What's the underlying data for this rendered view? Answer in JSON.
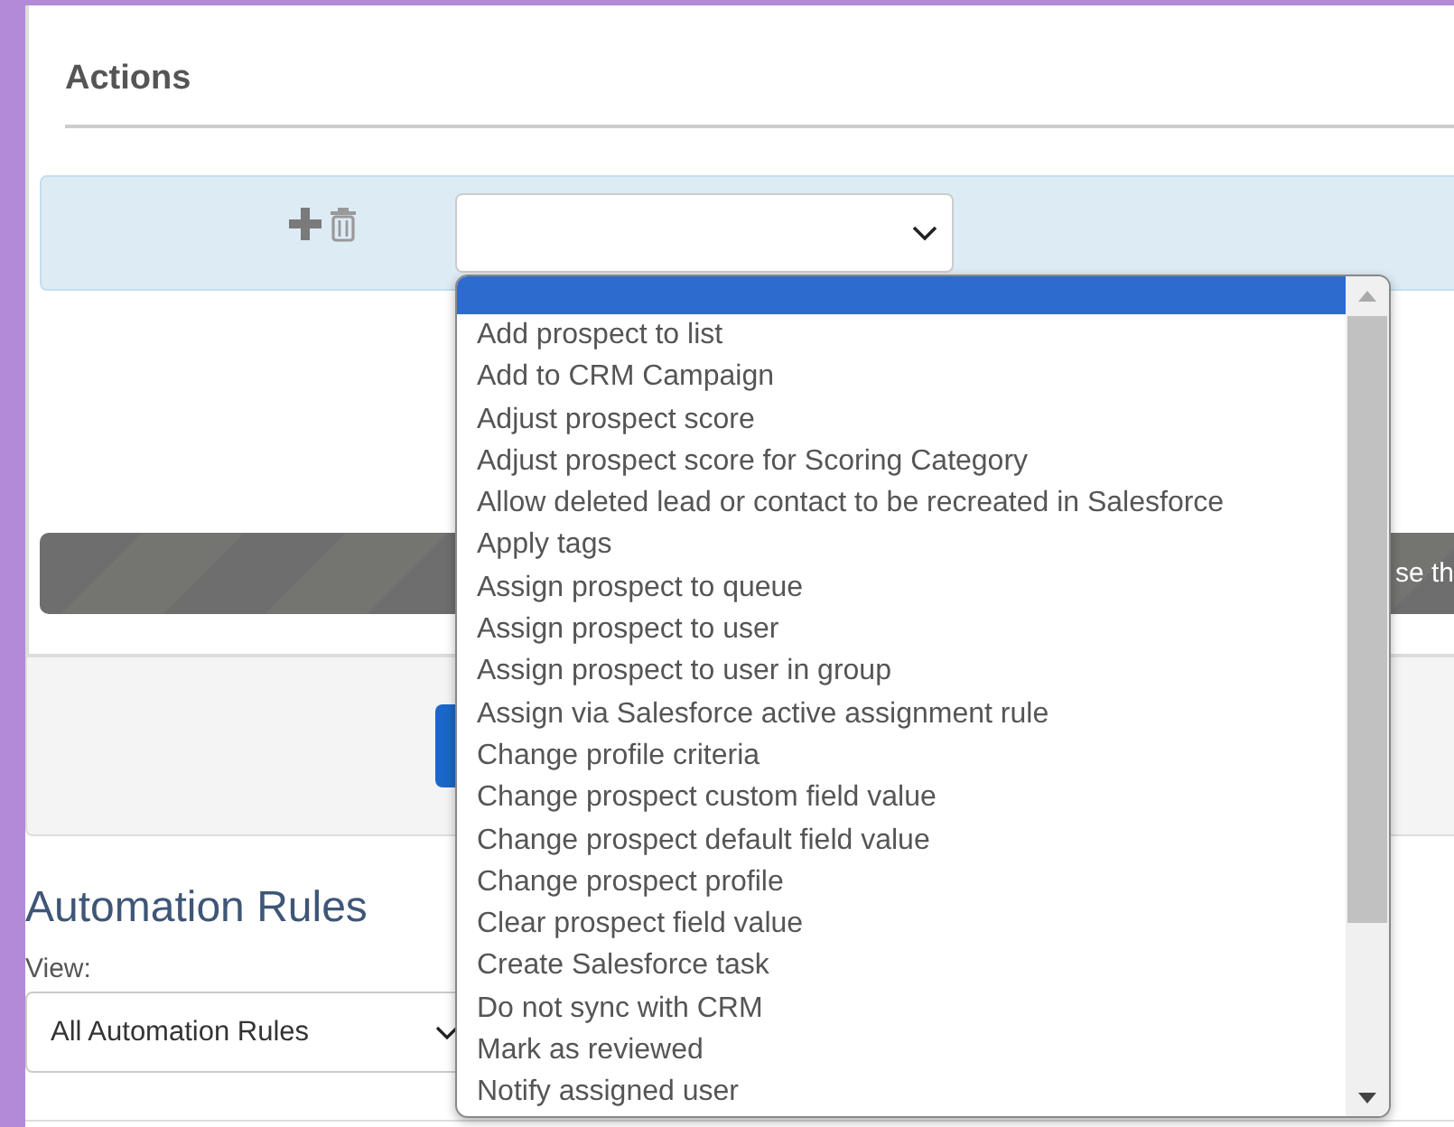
{
  "actions": {
    "title": "Actions",
    "dropdown": {
      "blank_option_selected": true,
      "options": [
        {
          "label": "Add prospect to list",
          "selected": false
        },
        {
          "label": "Add to CRM Campaign",
          "selected": false
        },
        {
          "label": "Adjust prospect score",
          "selected": false
        },
        {
          "label": "Adjust prospect score for Scoring Category",
          "selected": false
        },
        {
          "label": "Allow deleted lead or contact to be recreated in Salesforce",
          "selected": false
        },
        {
          "label": "Apply tags",
          "selected": false
        },
        {
          "label": "Assign prospect to queue",
          "selected": false
        },
        {
          "label": "Assign prospect to user",
          "selected": false
        },
        {
          "label": "Assign prospect to user in group",
          "selected": false
        },
        {
          "label": "Assign via Salesforce active assignment rule",
          "selected": false
        },
        {
          "label": "Change profile criteria",
          "selected": false
        },
        {
          "label": "Change prospect custom field value",
          "selected": false
        },
        {
          "label": "Change prospect default field value",
          "selected": false
        },
        {
          "label": "Change prospect profile",
          "selected": false
        },
        {
          "label": "Clear prospect field value",
          "selected": false
        },
        {
          "label": "Create Salesforce task",
          "selected": false
        },
        {
          "label": "Do not sync with CRM",
          "selected": false
        },
        {
          "label": "Mark as reviewed",
          "selected": false
        },
        {
          "label": "Notify assigned user",
          "selected": false
        }
      ]
    },
    "banner_text": "se th"
  },
  "automation_rules": {
    "title": "Automation Rules",
    "view_label": "View:",
    "view_value": "All Automation Rules"
  }
}
